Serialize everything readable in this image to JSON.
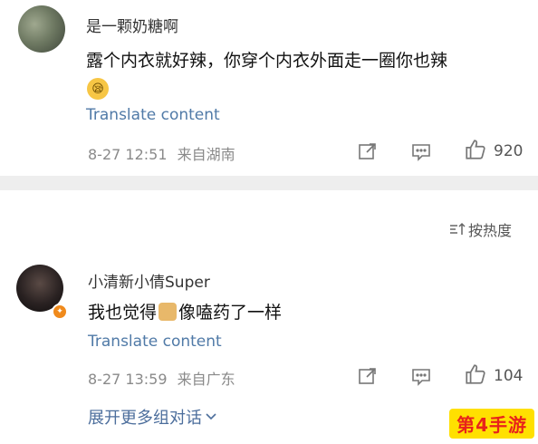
{
  "comments": [
    {
      "username": "是一颗奶糖啊",
      "text": "露个内衣就好辣，你穿个内衣外面走一圈你也辣",
      "translate": "Translate content",
      "timestamp": "8-27 12:51",
      "source": "来自湖南",
      "likes": "920"
    },
    {
      "username": "小清新小倩Super",
      "text_before": "我也觉得",
      "text_after": "像嗑药了一样",
      "translate": "Translate content",
      "timestamp": "8-27 13:59",
      "source": "来自广东",
      "likes": "104"
    }
  ],
  "sort_label": "按热度",
  "expand_more": "展开更多组对话",
  "watermark": "第4手游",
  "icons": [
    "share-icon",
    "comment-icon",
    "like-icon",
    "sort-icon",
    "chevron-down-icon",
    "emoji-icon"
  ]
}
